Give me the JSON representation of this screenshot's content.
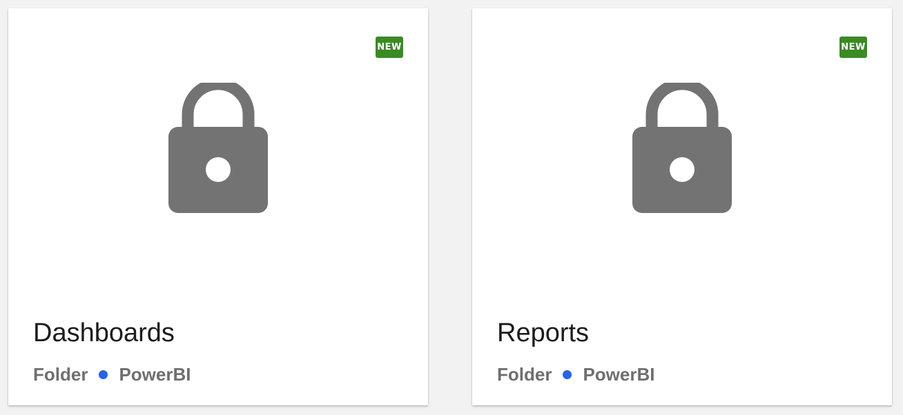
{
  "colors": {
    "background": "#f2f2f2",
    "card": "#ffffff",
    "badge": "#3a8b22",
    "lock": "#737373",
    "title": "#1c1c1c",
    "meta_text": "#6f6f6f",
    "dot": "#2563eb"
  },
  "cards": [
    {
      "badge": "NEW",
      "icon": "lock-icon",
      "title": "Dashboards",
      "type": "Folder",
      "source": "PowerBI"
    },
    {
      "badge": "NEW",
      "icon": "lock-icon",
      "title": "Reports",
      "type": "Folder",
      "source": "PowerBI"
    }
  ]
}
